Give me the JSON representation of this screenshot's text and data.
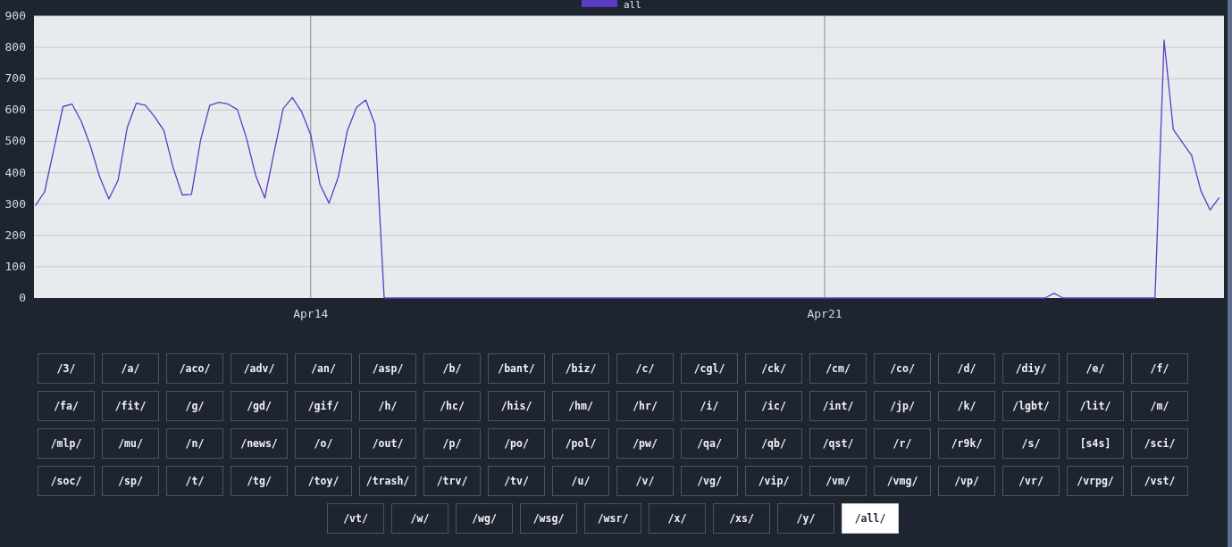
{
  "chart": {
    "chart_data": {
      "type": "line",
      "grid": true,
      "ylim": [
        0,
        900
      ],
      "yticks": [
        0,
        100,
        200,
        300,
        400,
        500,
        600,
        700,
        800,
        900
      ],
      "categories": [
        null,
        null,
        null,
        null,
        null,
        null,
        null,
        null,
        null,
        null,
        null,
        null,
        null,
        null,
        null,
        null,
        null,
        null,
        null,
        null,
        null,
        null,
        null,
        null,
        null,
        null,
        null,
        null,
        null,
        null,
        "Apr14",
        null,
        null,
        null,
        null,
        null,
        null,
        null,
        null,
        null,
        null,
        null,
        null,
        null,
        null,
        null,
        null,
        null,
        null,
        null,
        null,
        null,
        null,
        null,
        null,
        null,
        null,
        null,
        null,
        null,
        null,
        null,
        null,
        null,
        null,
        null,
        null,
        null,
        null,
        null,
        null,
        null,
        null,
        null,
        null,
        null,
        null,
        null,
        null,
        null,
        null,
        null,
        null,
        null,
        null,
        null,
        "Apr21",
        null,
        null,
        null,
        null,
        null,
        null,
        null,
        null,
        null,
        null,
        null,
        null,
        null,
        null,
        null,
        null,
        null,
        null,
        null,
        null,
        null,
        null,
        null,
        null,
        null,
        null,
        null,
        null,
        null,
        null,
        null,
        null,
        null,
        null,
        null,
        null,
        null,
        null,
        null,
        null,
        null,
        null,
        null
      ],
      "series": [
        {
          "name": "all",
          "color": "#5b3cc4",
          "values": [
            295,
            339,
            474,
            611,
            619,
            564,
            485,
            387,
            316,
            375,
            544,
            622,
            615,
            578,
            535,
            417,
            329,
            331,
            504,
            615,
            625,
            619,
            602,
            510,
            391,
            319,
            464,
            605,
            640,
            595,
            521,
            363,
            303,
            386,
            535,
            609,
            632,
            554,
            0,
            0,
            0,
            0,
            0,
            0,
            0,
            0,
            0,
            0,
            0,
            0,
            0,
            0,
            0,
            0,
            0,
            0,
            0,
            0,
            0,
            0,
            0,
            0,
            0,
            0,
            0,
            0,
            0,
            0,
            0,
            0,
            0,
            0,
            0,
            0,
            0,
            0,
            0,
            0,
            0,
            0,
            0,
            0,
            0,
            0,
            0,
            0,
            0,
            0,
            0,
            0,
            0,
            0,
            0,
            0,
            0,
            0,
            0,
            0,
            0,
            0,
            0,
            0,
            0,
            0,
            0,
            0,
            0,
            0,
            0,
            0,
            0,
            15,
            0,
            0,
            0,
            0,
            0,
            0,
            0,
            0,
            0,
            0,
            0,
            823,
            538,
            496,
            455,
            343,
            281,
            321
          ]
        }
      ]
    }
  },
  "boards": [
    {
      "label": "/3/",
      "selected": false
    },
    {
      "label": "/a/",
      "selected": false
    },
    {
      "label": "/aco/",
      "selected": false
    },
    {
      "label": "/adv/",
      "selected": false
    },
    {
      "label": "/an/",
      "selected": false
    },
    {
      "label": "/asp/",
      "selected": false
    },
    {
      "label": "/b/",
      "selected": false
    },
    {
      "label": "/bant/",
      "selected": false
    },
    {
      "label": "/biz/",
      "selected": false
    },
    {
      "label": "/c/",
      "selected": false
    },
    {
      "label": "/cgl/",
      "selected": false
    },
    {
      "label": "/ck/",
      "selected": false
    },
    {
      "label": "/cm/",
      "selected": false
    },
    {
      "label": "/co/",
      "selected": false
    },
    {
      "label": "/d/",
      "selected": false
    },
    {
      "label": "/diy/",
      "selected": false
    },
    {
      "label": "/e/",
      "selected": false
    },
    {
      "label": "/f/",
      "selected": false
    },
    {
      "label": "/fa/",
      "selected": false
    },
    {
      "label": "/fit/",
      "selected": false
    },
    {
      "label": "/g/",
      "selected": false
    },
    {
      "label": "/gd/",
      "selected": false
    },
    {
      "label": "/gif/",
      "selected": false
    },
    {
      "label": "/h/",
      "selected": false
    },
    {
      "label": "/hc/",
      "selected": false
    },
    {
      "label": "/his/",
      "selected": false
    },
    {
      "label": "/hm/",
      "selected": false
    },
    {
      "label": "/hr/",
      "selected": false
    },
    {
      "label": "/i/",
      "selected": false
    },
    {
      "label": "/ic/",
      "selected": false
    },
    {
      "label": "/int/",
      "selected": false
    },
    {
      "label": "/jp/",
      "selected": false
    },
    {
      "label": "/k/",
      "selected": false
    },
    {
      "label": "/lgbt/",
      "selected": false
    },
    {
      "label": "/lit/",
      "selected": false
    },
    {
      "label": "/m/",
      "selected": false
    },
    {
      "label": "/mlp/",
      "selected": false
    },
    {
      "label": "/mu/",
      "selected": false
    },
    {
      "label": "/n/",
      "selected": false
    },
    {
      "label": "/news/",
      "selected": false
    },
    {
      "label": "/o/",
      "selected": false
    },
    {
      "label": "/out/",
      "selected": false
    },
    {
      "label": "/p/",
      "selected": false
    },
    {
      "label": "/po/",
      "selected": false
    },
    {
      "label": "/pol/",
      "selected": false
    },
    {
      "label": "/pw/",
      "selected": false
    },
    {
      "label": "/qa/",
      "selected": false
    },
    {
      "label": "/qb/",
      "selected": false
    },
    {
      "label": "/qst/",
      "selected": false
    },
    {
      "label": "/r/",
      "selected": false
    },
    {
      "label": "/r9k/",
      "selected": false
    },
    {
      "label": "/s/",
      "selected": false
    },
    {
      "label": "[s4s]",
      "selected": false
    },
    {
      "label": "/sci/",
      "selected": false
    },
    {
      "label": "/soc/",
      "selected": false
    },
    {
      "label": "/sp/",
      "selected": false
    },
    {
      "label": "/t/",
      "selected": false
    },
    {
      "label": "/tg/",
      "selected": false
    },
    {
      "label": "/toy/",
      "selected": false
    },
    {
      "label": "/trash/",
      "selected": false
    },
    {
      "label": "/trv/",
      "selected": false
    },
    {
      "label": "/tv/",
      "selected": false
    },
    {
      "label": "/u/",
      "selected": false
    },
    {
      "label": "/v/",
      "selected": false
    },
    {
      "label": "/vg/",
      "selected": false
    },
    {
      "label": "/vip/",
      "selected": false
    },
    {
      "label": "/vm/",
      "selected": false
    },
    {
      "label": "/vmg/",
      "selected": false
    },
    {
      "label": "/vp/",
      "selected": false
    },
    {
      "label": "/vr/",
      "selected": false
    },
    {
      "label": "/vrpg/",
      "selected": false
    },
    {
      "label": "/vst/",
      "selected": false
    },
    {
      "label": "/vt/",
      "selected": false
    },
    {
      "label": "/w/",
      "selected": false
    },
    {
      "label": "/wg/",
      "selected": false
    },
    {
      "label": "/wsg/",
      "selected": false
    },
    {
      "label": "/wsr/",
      "selected": false
    },
    {
      "label": "/x/",
      "selected": false
    },
    {
      "label": "/xs/",
      "selected": false
    },
    {
      "label": "/y/",
      "selected": false
    },
    {
      "label": "/all/",
      "selected": true
    }
  ]
}
